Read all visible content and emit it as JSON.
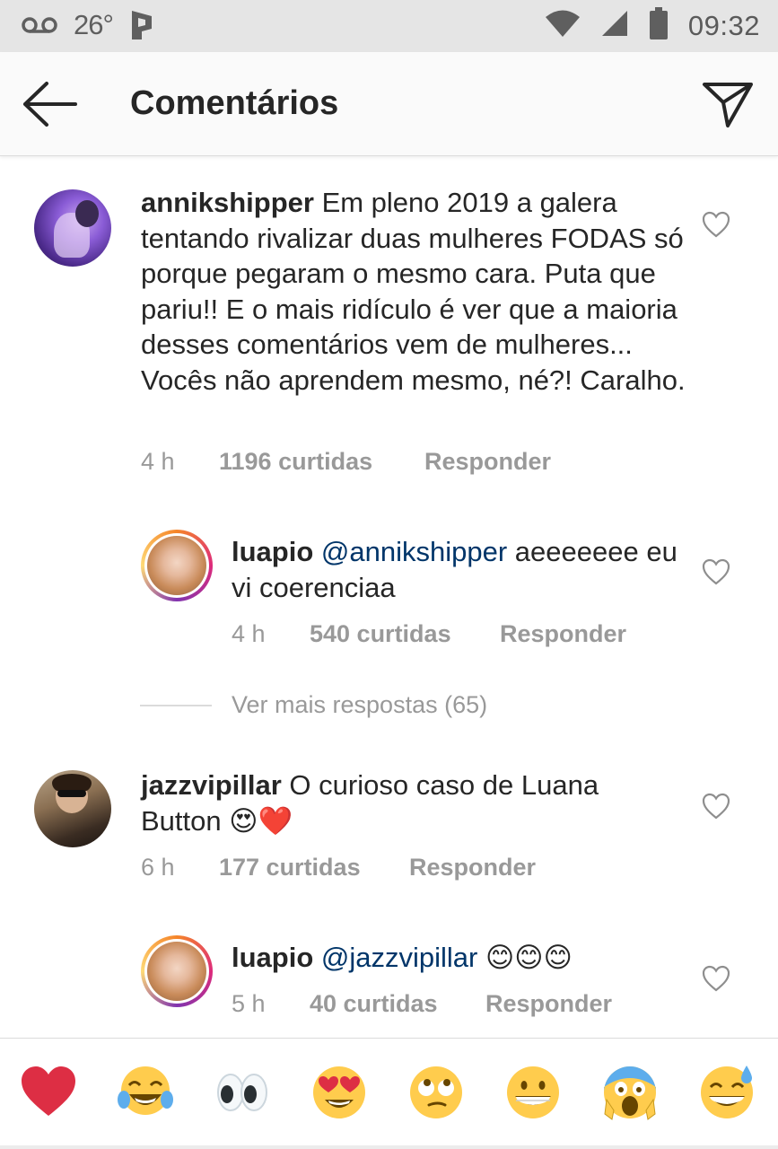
{
  "status_bar": {
    "temperature": "26°",
    "time": "09:32"
  },
  "header": {
    "title": "Comentários"
  },
  "comments": [
    {
      "user": "annikshipper",
      "text": "Em pleno 2019 a galera tentando rivalizar duas mulheres FODAS só porque pegaram o mesmo cara. Puta que pariu!! E o mais ridículo é ver que a maioria desses comentários vem de mulheres... Vocês não aprendem mesmo, né?! Caralho.",
      "time": "4 h",
      "likes": "1196 curtidas",
      "reply_label": "Responder"
    },
    {
      "user": "luapio",
      "mention": "@annikshipper",
      "text": "aeeeeeee eu vi coerenciaa",
      "time": "4 h",
      "likes": "540 curtidas",
      "reply_label": "Responder"
    },
    {
      "user": "jazzvipillar",
      "text": "O curioso caso de Luana Button 😍❤️",
      "time": "6 h",
      "likes": "177 curtidas",
      "reply_label": "Responder"
    },
    {
      "user": "luapio",
      "mention": "@jazzvipillar",
      "text": "😊😊😊",
      "time": "5 h",
      "likes": "40 curtidas",
      "reply_label": "Responder"
    }
  ],
  "more_replies": "Ver mais respostas (65)",
  "emoji_bar": [
    "red-heart",
    "tears-of-joy",
    "eyes",
    "heart-eyes",
    "rolling-eyes",
    "grinning",
    "screaming",
    "sweat-smile"
  ]
}
